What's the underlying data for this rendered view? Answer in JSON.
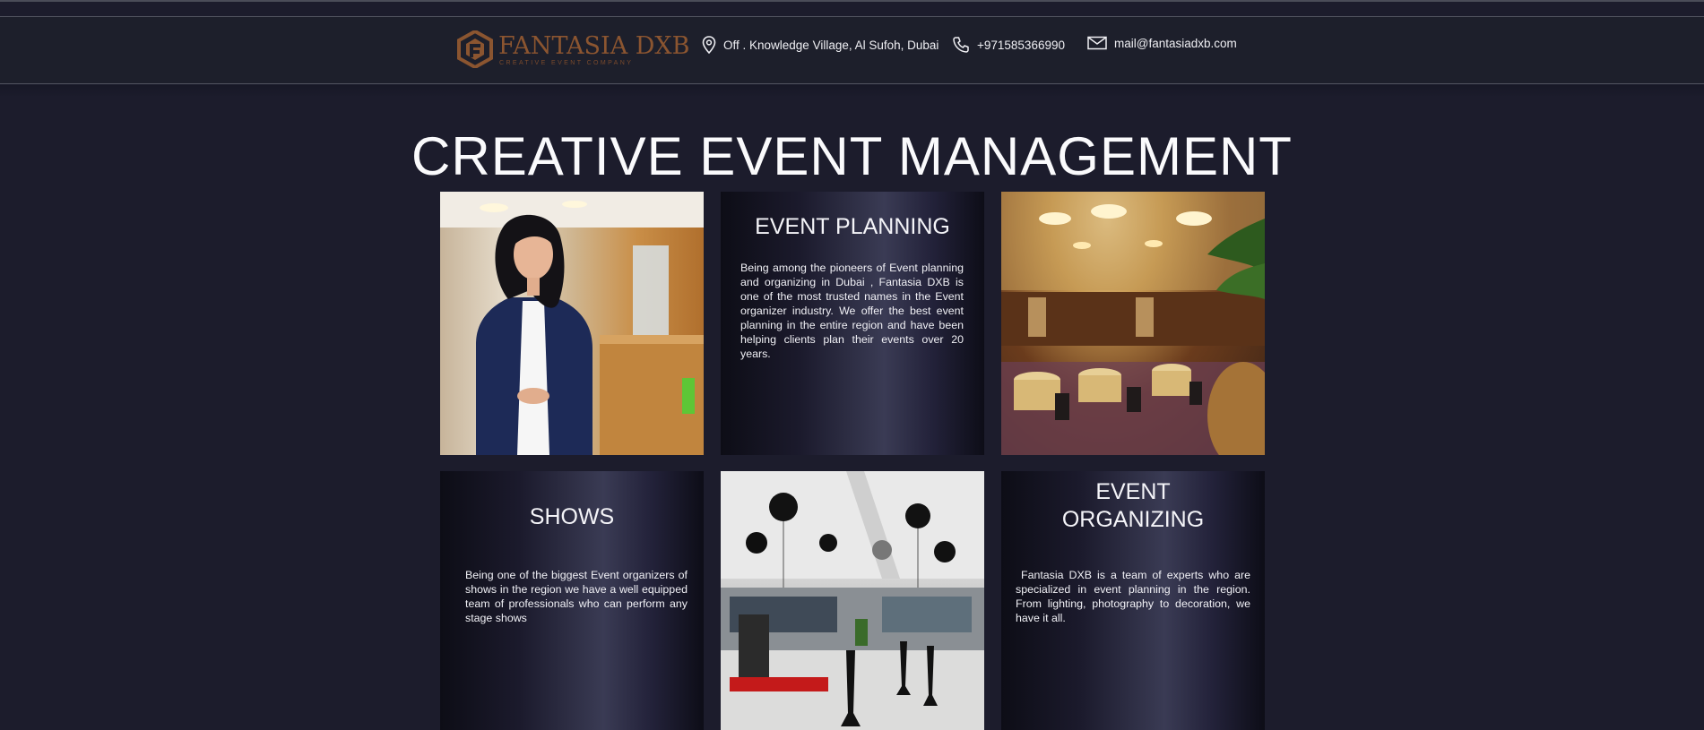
{
  "header": {
    "logo": {
      "name": "FANTASIA DXB",
      "tagline": "CREATIVE EVENT COMPANY"
    },
    "address": "Off . Knowledge Village, Al Sufoh, Dubai",
    "phone": "+971585366990",
    "email": "mail@fantasiadxb.com",
    "icons": [
      "location-pin-icon",
      "phone-icon",
      "envelope-icon"
    ]
  },
  "main": {
    "title": "CREATIVE EVENT MANAGEMENT",
    "cards": [
      {
        "heading": "EVENT PLANNING",
        "text": "Being among the pioneers of Event planning and organizing in Dubai , Fantasia DXB is one of the most trusted names in the Event organizer industry. We offer the best event planning in the entire region and have been helping clients plan their events over 20 years."
      },
      {
        "heading": "SHOWS",
        "text": "Being one of the biggest Event organizers of shows in the region we have a well equipped team of professionals who can perform any stage shows"
      },
      {
        "heading": "EVENT ORGANIZING",
        "text": " Fantasia DXB is a team of experts who are specialized in event planning in the region. From lighting, photography to decoration, we have it all."
      }
    ]
  },
  "colors": {
    "background": "#1c1c2c",
    "header": "#1d1f2b",
    "logo": "#8b5530",
    "text": "#f2f2f6"
  }
}
